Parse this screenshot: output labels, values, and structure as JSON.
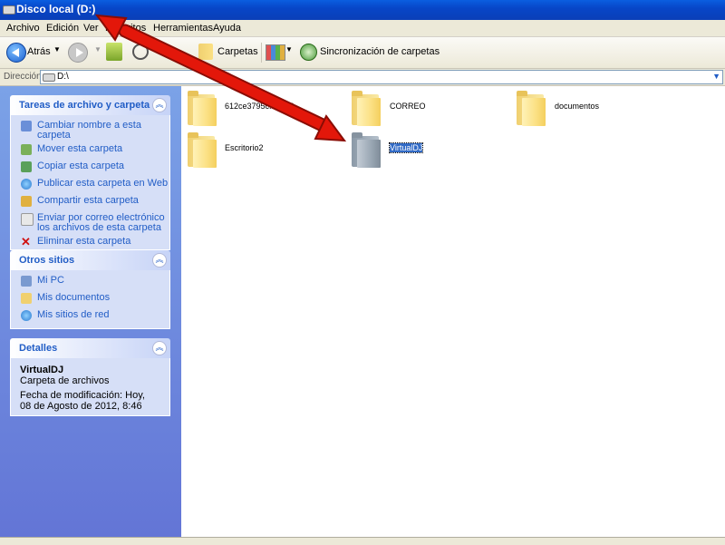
{
  "window": {
    "title": "Disco local (D:)"
  },
  "menu": [
    "Archivo",
    "Edición",
    "Ver",
    "Favoritos",
    "Herramientas",
    "Ayuda"
  ],
  "toolbar": {
    "back_label": "Atrás",
    "folders_label": "Carpetas",
    "sync_label": "Sincronización de carpetas"
  },
  "address": {
    "label": "Dirección",
    "value": "D:\\"
  },
  "tasks_panel": {
    "title": "Tareas de archivo y carpeta",
    "items": [
      "Cambiar nombre a esta carpeta",
      "Mover esta carpeta",
      "Copiar esta carpeta",
      "Publicar esta carpeta en Web",
      "Compartir esta carpeta",
      "Enviar por correo electrónico los archivos de esta carpeta",
      "Eliminar esta carpeta"
    ]
  },
  "places_panel": {
    "title": "Otros sitios",
    "items": [
      "Mi PC",
      "Mis documentos",
      "Mis sitios de red"
    ]
  },
  "details_panel": {
    "title": "Detalles",
    "name": "VirtualDJ",
    "type": "Carpeta de archivos",
    "modified": "Fecha de modificación: Hoy, 08 de Agosto de 2012, 8:46"
  },
  "folders": [
    {
      "name": "612ce3795c...0e06"
    },
    {
      "name": "CORREO"
    },
    {
      "name": "documentos"
    },
    {
      "name": "Escritorio2"
    },
    {
      "name": "VirtualDJ",
      "selected": true
    }
  ],
  "colors": {
    "title_blue": "#0a46c8",
    "link_blue": "#215dc6",
    "annotation_arrow": "#e3170a"
  }
}
